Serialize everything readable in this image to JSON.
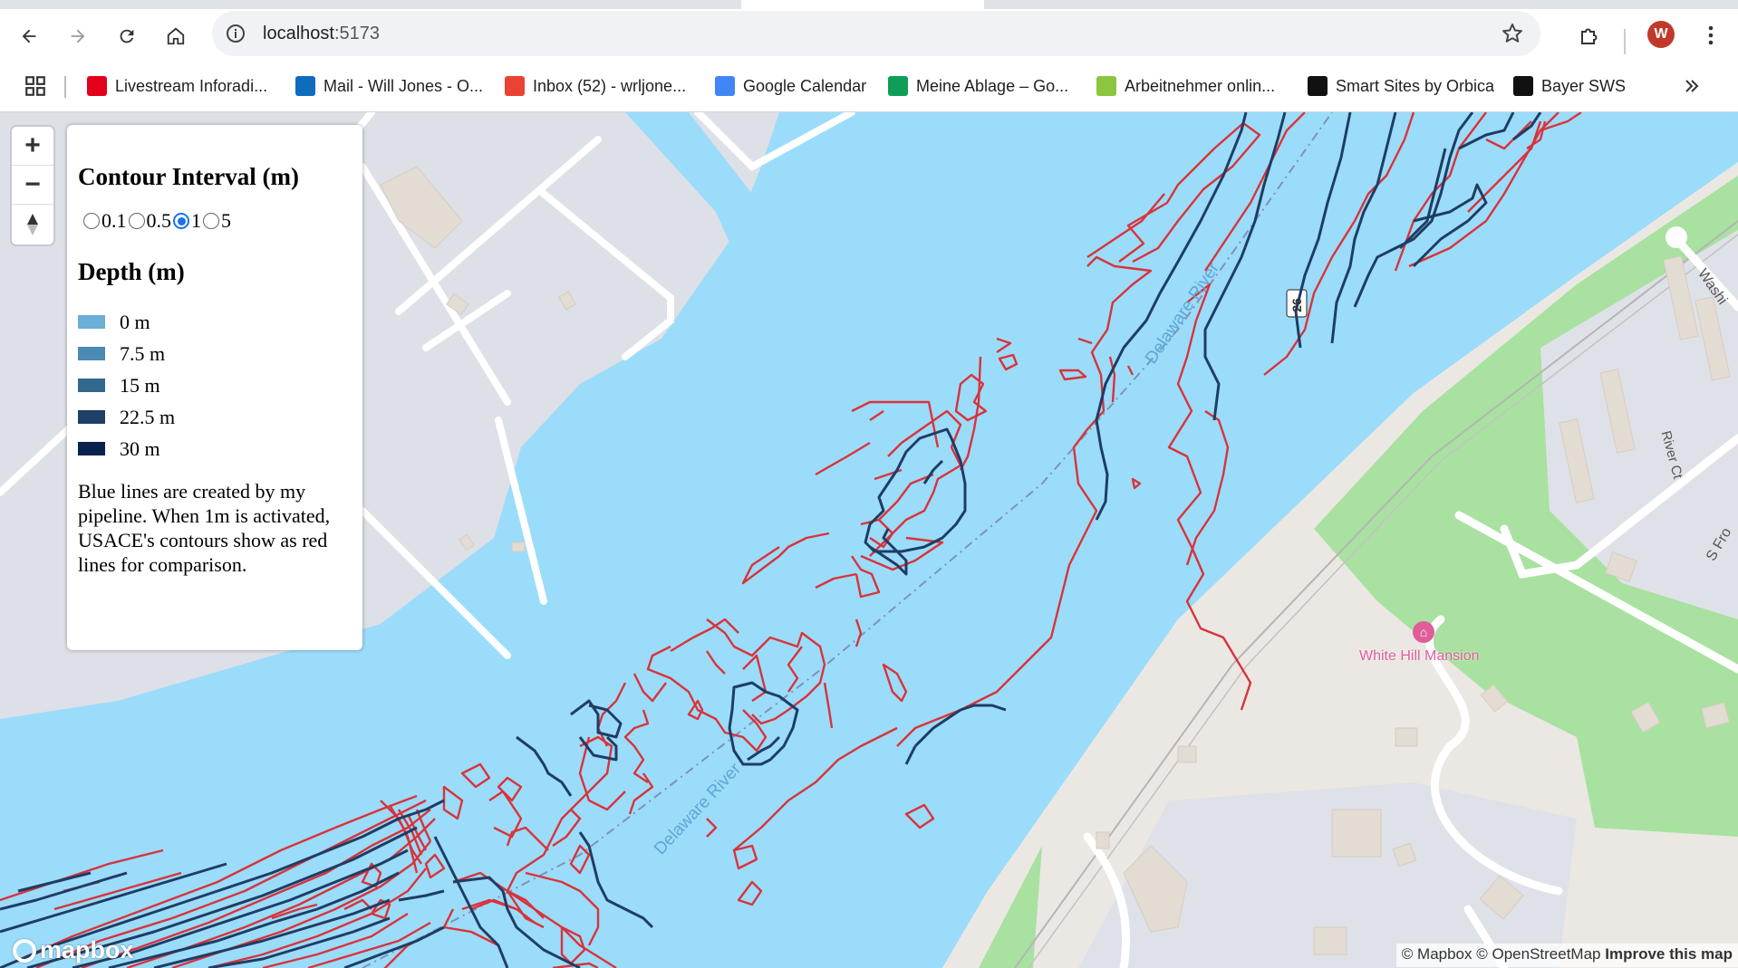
{
  "browser": {
    "url_host": "localhost",
    "url_port": ":5173",
    "avatar_letter": "W",
    "bookmarks": [
      {
        "label": "Livestream Inforadi...",
        "icon": "rbb-icon",
        "color": "#e2001a"
      },
      {
        "label": "Mail - Will Jones - O...",
        "icon": "outlook-icon",
        "color": "#0f6cbd"
      },
      {
        "label": "Inbox (52) - wrljone...",
        "icon": "gmail-icon",
        "color": "#ea4335"
      },
      {
        "label": "Google Calendar",
        "icon": "calendar-icon",
        "color": "#4285f4"
      },
      {
        "label": "Meine Ablage – Go...",
        "icon": "drive-icon",
        "color": "#0f9d58"
      },
      {
        "label": "Arbeitnehmer onlin...",
        "icon": "datev-icon",
        "color": "#8cc63f"
      },
      {
        "label": "Smart Sites by Orbica",
        "icon": "orbica-icon",
        "color": "#111111"
      },
      {
        "label": "Bayer SWS",
        "icon": "orbica-icon",
        "color": "#111111"
      }
    ]
  },
  "legend": {
    "contour_title": "Contour Interval (m)",
    "intervals": [
      "0.1",
      "0.5",
      "1",
      "5"
    ],
    "selected_interval": "1",
    "depth_title": "Depth (m)",
    "depths": [
      {
        "label": "0 m",
        "color": "#6baed6"
      },
      {
        "label": "7.5 m",
        "color": "#4a8ab4"
      },
      {
        "label": "15 m",
        "color": "#31688e"
      },
      {
        "label": "22.5 m",
        "color": "#1e3f66"
      },
      {
        "label": "30 m",
        "color": "#08224d"
      }
    ],
    "note": "Blue lines are created by my pipeline. When 1m is activated, USACE's contours show as red lines for comparison."
  },
  "map": {
    "labels": {
      "river_upper": "Delaware River",
      "river_lower": "Delaware River",
      "route_shield": "26",
      "poi": "White Hill Mansion",
      "street_river_ct": "River Ct",
      "street_s_front": "S Fro",
      "street_wash": "Washi"
    },
    "logo": "mapbox",
    "attribution_prefix": "© Mapbox © OpenStreetMap",
    "attribution_link": "Improve this map",
    "colors": {
      "water": "#9bdcfb",
      "land": "#dde0e6",
      "park": "#a8e1a0",
      "usace_contours": "#d9333a",
      "pipeline_contours": "#1f3d63"
    }
  }
}
